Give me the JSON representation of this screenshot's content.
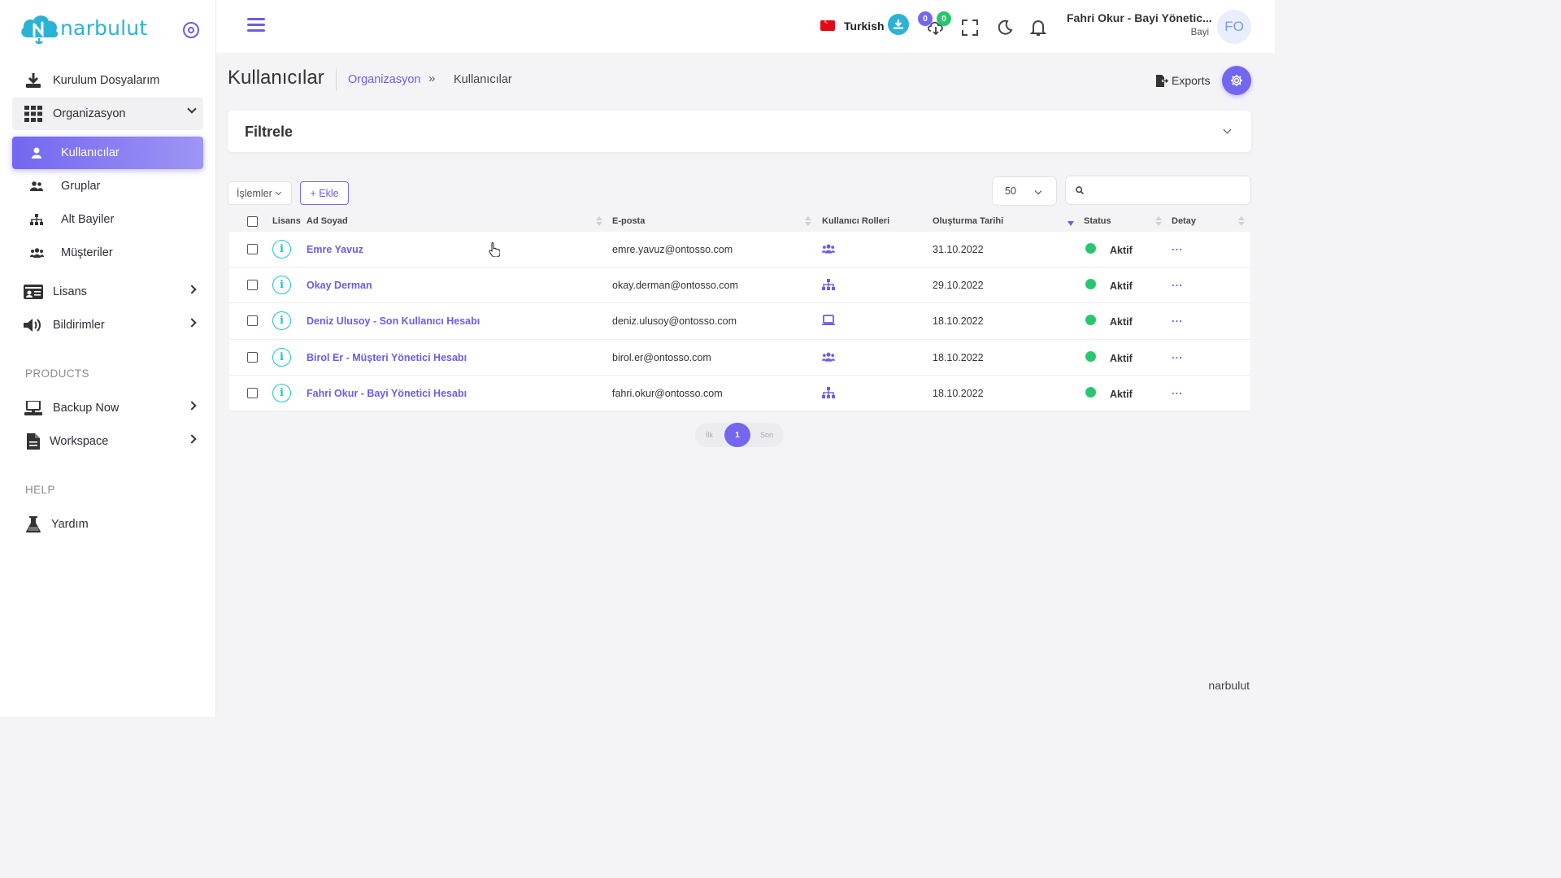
{
  "brand": {
    "logo_text": "narbulut",
    "footer_text": "narbulut"
  },
  "sidebar": {
    "items": [
      {
        "label": "Kurulum Dosyalarım"
      },
      {
        "label": "Organizasyon"
      },
      {
        "label": "Kullanıcılar"
      },
      {
        "label": "Gruplar"
      },
      {
        "label": "Alt Bayiler"
      },
      {
        "label": "Müşteriler"
      },
      {
        "label": "Lisans"
      },
      {
        "label": "Bildirimler"
      },
      {
        "label": "Backup Now"
      },
      {
        "label": "Workspace"
      },
      {
        "label": "Yardım"
      }
    ],
    "sections": {
      "products": "PRODUCTS",
      "help": "HELP"
    }
  },
  "header": {
    "language": "Turkish",
    "badge_count_1": "0",
    "badge_count_2": "0",
    "user_name": "Fahri Okur - Bayi Yönetic...",
    "user_role": "Bayi",
    "avatar_initials": "FO"
  },
  "page": {
    "title": "Kullanıcılar",
    "breadcrumb": [
      "Organizasyon",
      "»",
      "Kullanıcılar"
    ],
    "exports_label": "Exports",
    "filter_title": "Filtrele"
  },
  "toolbar": {
    "operations_label": "İşlemler",
    "add_label": "+ Ekle",
    "page_size": "50",
    "search_value": ""
  },
  "table": {
    "columns": [
      "Lisans",
      "Ad Soyad",
      "E-posta",
      "Kullanıcı Rolleri",
      "Oluşturma Tarihi",
      "Status",
      "Detay"
    ],
    "rows": [
      {
        "name": "Emre Yavuz",
        "email": "emre.yavuz@ontosso.com",
        "role_icon": "users-icon",
        "date": "31.10.2022",
        "status": "Aktif",
        "detail": "..."
      },
      {
        "name": "Okay Derman",
        "email": "okay.derman@ontosso.com",
        "role_icon": "sitemap-icon",
        "date": "29.10.2022",
        "status": "Aktif",
        "detail": "..."
      },
      {
        "name": "Deniz Ulusoy - Son Kullanıcı Hesabı",
        "email": "deniz.ulusoy@ontosso.com",
        "role_icon": "laptop-icon",
        "date": "18.10.2022",
        "status": "Aktif",
        "detail": "..."
      },
      {
        "name": "Birol Er - Müşteri Yönetici Hesabı",
        "email": "birol.er@ontosso.com",
        "role_icon": "users-icon",
        "date": "18.10.2022",
        "status": "Aktif",
        "detail": "..."
      },
      {
        "name": "Fahri Okur - Bayi Yönetici Hesabı",
        "email": "fahri.okur@ontosso.com",
        "role_icon": "sitemap-icon",
        "date": "18.10.2022",
        "status": "Aktif",
        "detail": "..."
      }
    ]
  },
  "pagination": {
    "first": "İlk",
    "current": "1",
    "last": "Son"
  },
  "colors": {
    "accent": "#7367f0",
    "info": "#18c3d8",
    "status_active": "#28c76f",
    "logo": "#2ab3d6"
  }
}
